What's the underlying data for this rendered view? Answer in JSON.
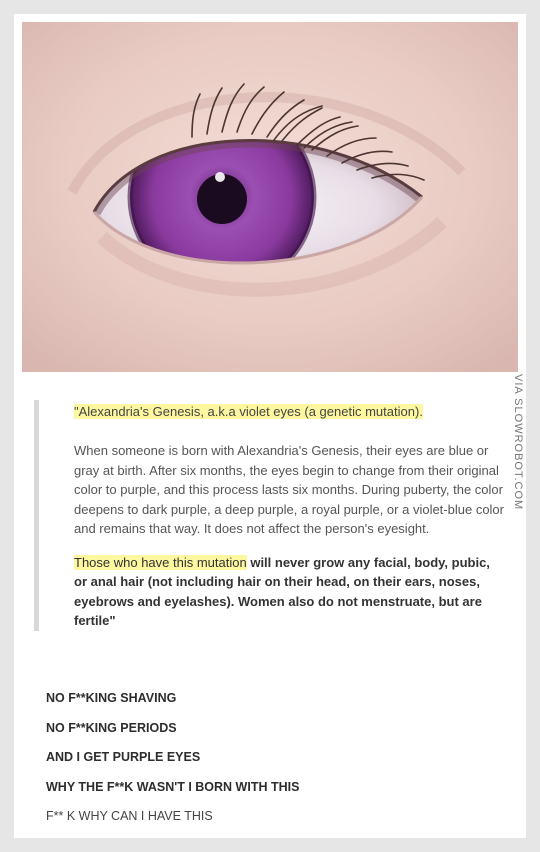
{
  "image": {
    "alt": "violet eye photo"
  },
  "watermark": "VIA SLOWROBOT.COM",
  "quote": {
    "title": "\"Alexandria's Genesis, a.k.a violet eyes (a genetic mutation).",
    "paragraph1": "When someone is born with Alexandria's Genesis, their eyes are blue or gray at birth. After six months, the eyes begin to change from their original color to purple, and this process lasts six months. During puberty, the color deepens to dark purple, a deep purple, a royal purple, or a violet-blue color and remains that way. It does not affect the person's eyesight.",
    "highlight2": "Those who have this mutation",
    "paragraph2_rest": " will never grow any facial, body, pubic, or anal hair (not including hair on their head, on their ears, noses, eyebrows and eyelashes). Women also do not menstruate, but are fertile\""
  },
  "comments": [
    "NO F**KING SHAVING",
    "NO F**KING PERIODS",
    "AND I GET PURPLE EYES",
    "WHY THE F**K WASN'T I BORN WITH THIS",
    "F** K WHY CAN I HAVE THIS"
  ],
  "colors": {
    "iris": "#8a3a9e",
    "highlight": "#fdf7a0",
    "background": "#e6e6e6"
  }
}
